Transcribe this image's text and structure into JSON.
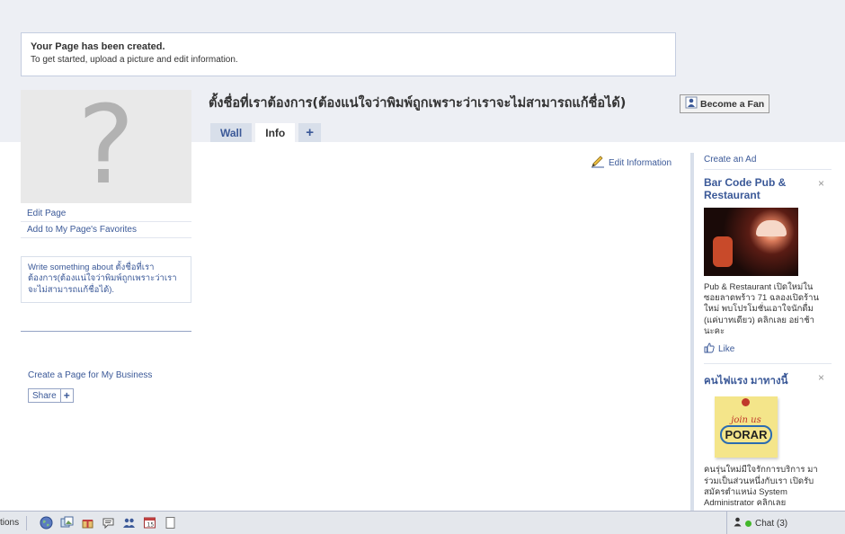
{
  "notice": {
    "title": "Your Page has been created.",
    "text": "To get started, upload a picture and edit information."
  },
  "profile": {
    "placeholder_glyph": "?"
  },
  "left_menu": {
    "edit_page": "Edit Page",
    "add_favorites": "Add to My Page's Favorites",
    "about_prompt": "Write something about ตั้งชื่อที่เราต้องการ(ต้องแน่ใจว่าพิมพ์ถูกเพราะว่าเราจะไม่สามารถแก้ชื่อได้).",
    "create_business": "Create a Page for My Business",
    "share_label": "Share",
    "share_plus": "+"
  },
  "page": {
    "title": "ตั้งชื่อที่เราต้องการ(ต้องแน่ใจว่าพิมพ์ถูกเพราะว่าเราจะไม่สามารถแก้ชื่อได้)",
    "become_fan": "Become a Fan",
    "edit_information": "Edit Information"
  },
  "tabs": [
    {
      "label": "Wall",
      "active": false
    },
    {
      "label": "Info",
      "active": true
    },
    {
      "label": "+",
      "active": false
    }
  ],
  "sidebar": {
    "create_ad": "Create an Ad",
    "ads": [
      {
        "title": "Bar Code Pub & Restaurant",
        "close": "×",
        "description": "Pub & Restaurant เปิดใหม่ใน ซอยลาดพร้าว 71 ฉลองเปิดร้าน ใหม่ พบโปรโมชั่นเอาใจนักดื่ม (แค่บาทเดียว) คลิกเลย อย่าช้า นะคะ",
        "like": "Like"
      },
      {
        "title": "คนไฟแรง มาทางนี้",
        "close": "×",
        "image_text_1": "join us",
        "image_text_2": "PORAR",
        "description": "คนรุ่นใหม่มีใจรักการบริการ มา ร่วมเป็นส่วนหนึ่งกับเรา เปิดรับ สมัครตำแหน่ง System Administrator คลิกเลย"
      }
    ]
  },
  "chatbar": {
    "applications_label": "tions",
    "chat_label": "Chat (3)",
    "icons": [
      "globe-icon",
      "photos-icon",
      "gifts-icon",
      "notes-icon",
      "friends-icon",
      "events-icon",
      "blank-icon"
    ]
  },
  "colors": {
    "link": "#3b5998",
    "band": "#edeff4",
    "tab_bg": "#d8dfea"
  }
}
